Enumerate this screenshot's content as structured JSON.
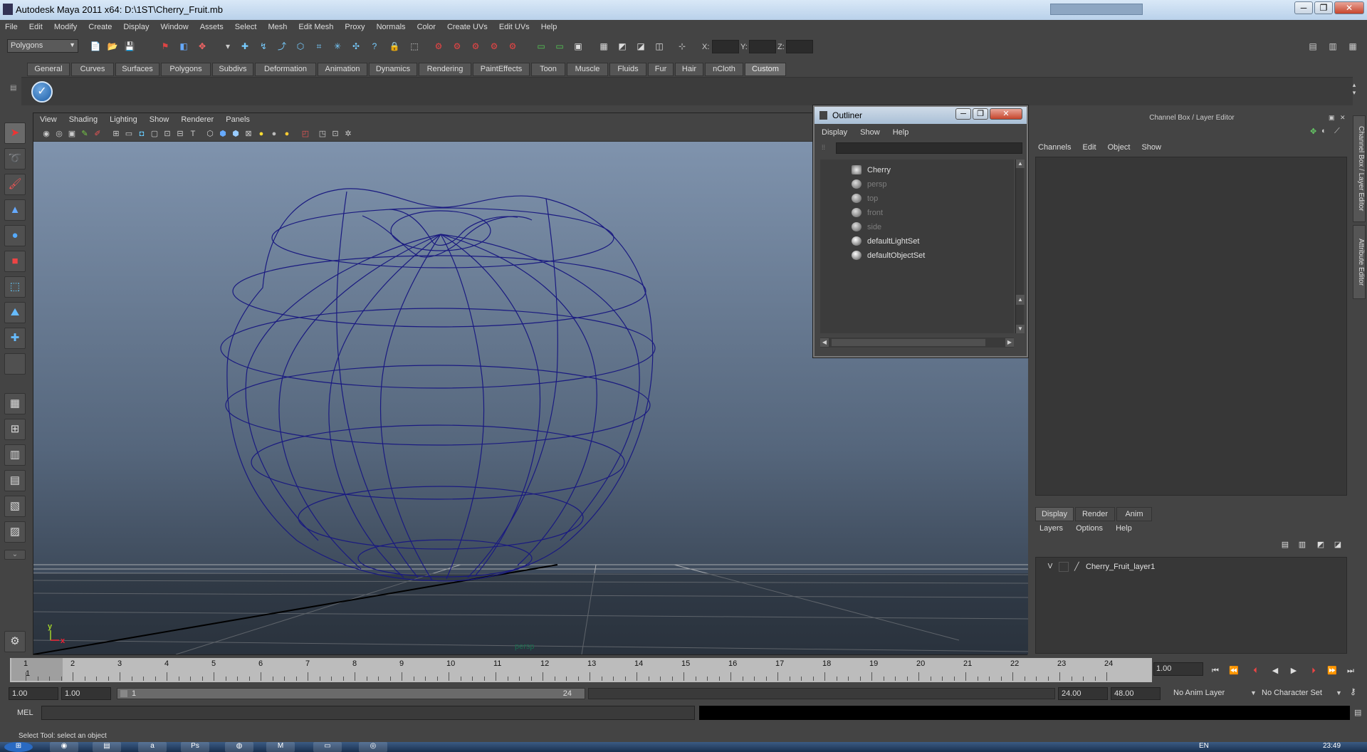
{
  "window": {
    "title": "Autodesk Maya 2011 x64: D:\\1ST\\Cherry_Fruit.mb",
    "search_placeholder": "",
    "minimize": "─",
    "restore": "❐",
    "close": "✕"
  },
  "menubar": [
    "File",
    "Edit",
    "Modify",
    "Create",
    "Display",
    "Window",
    "Assets",
    "Select",
    "Mesh",
    "Edit Mesh",
    "Proxy",
    "Normals",
    "Color",
    "Create UVs",
    "Edit UVs",
    "Help"
  ],
  "statusline": {
    "mode": "Polygons",
    "x_label": "X:",
    "y_label": "Y:",
    "z_label": "Z:"
  },
  "shelf_tabs": [
    "General",
    "Curves",
    "Surfaces",
    "Polygons",
    "Subdivs",
    "Deformation",
    "Animation",
    "Dynamics",
    "Rendering",
    "PaintEffects",
    "Toon",
    "Muscle",
    "Fluids",
    "Fur",
    "Hair",
    "nCloth",
    "Custom"
  ],
  "shelf_active_tab": "Custom",
  "viewport": {
    "menus": [
      "View",
      "Shading",
      "Lighting",
      "Show",
      "Renderer",
      "Panels"
    ],
    "camera": "persp",
    "axis_y": "y",
    "axis_x": "x",
    "wire_color": "#1a1a80"
  },
  "outliner": {
    "title": "Outliner",
    "menus": [
      "Display",
      "Show",
      "Help"
    ],
    "items": [
      {
        "label": "Cherry",
        "dim": false
      },
      {
        "label": "persp",
        "dim": true
      },
      {
        "label": "top",
        "dim": true
      },
      {
        "label": "front",
        "dim": true
      },
      {
        "label": "side",
        "dim": true
      },
      {
        "label": "defaultLightSet",
        "dim": false
      },
      {
        "label": "defaultObjectSet",
        "dim": false
      }
    ]
  },
  "channelbox": {
    "title": "Channel Box / Layer Editor",
    "menus": [
      "Channels",
      "Edit",
      "Object",
      "Show"
    ],
    "layer_tabs": [
      "Display",
      "Render",
      "Anim"
    ],
    "layer_menus": [
      "Layers",
      "Options",
      "Help"
    ],
    "layer": {
      "visible": "V",
      "name": "Cherry_Fruit_layer1"
    }
  },
  "side_tabs": [
    "Channel Box / Layer Editor",
    "Attribute Editor"
  ],
  "timeslider": {
    "ticks": [
      "1",
      "2",
      "3",
      "4",
      "5",
      "6",
      "7",
      "8",
      "9",
      "10",
      "11",
      "12",
      "13",
      "14",
      "15",
      "16",
      "17",
      "18",
      "19",
      "20",
      "21",
      "22",
      "23",
      "24"
    ],
    "current_frame": "1",
    "current_frame_field": "1.00"
  },
  "range": {
    "start_time": "1.00",
    "playback_start": "1.00",
    "range_start": "1",
    "range_end": "24",
    "playback_end": "24.00",
    "end_time": "48.00",
    "anim_layer": "No Anim Layer",
    "character_set": "No Character Set"
  },
  "cmdline": {
    "label": "MEL"
  },
  "helpline": "Select Tool: select an object",
  "taskbar": {
    "lang": "EN",
    "time": "23:49"
  }
}
